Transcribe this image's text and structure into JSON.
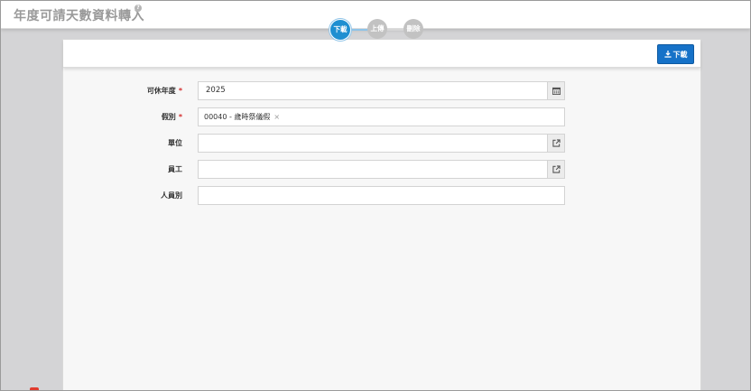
{
  "page": {
    "title": "年度可請天數資料轉入",
    "help_icon": "help-icon"
  },
  "stepper": {
    "steps": [
      {
        "label": "下載",
        "state": "active"
      },
      {
        "label": "上傳",
        "state": "inactive"
      },
      {
        "label": "刪除",
        "state": "inactive"
      }
    ]
  },
  "toolbar": {
    "download_label": "下載",
    "download_icon": "download-icon"
  },
  "form": {
    "year": {
      "label": "可休年度",
      "required": "*",
      "value": "2025",
      "button_icon": "calendar-icon"
    },
    "leave_type": {
      "label": "假別",
      "required": "*",
      "tag": "00040 - 歲時祭儀假",
      "remove": "×"
    },
    "unit": {
      "label": "單位",
      "value": "",
      "button_icon": "open-external-icon"
    },
    "employee": {
      "label": "員工",
      "value": "",
      "button_icon": "open-external-icon"
    },
    "staff_type": {
      "label": "人員別",
      "value": ""
    }
  },
  "colors": {
    "accent": "#1e8fd1",
    "button": "#1672c8",
    "required": "#d42b2b",
    "inactive_step": "#c2c2c2"
  }
}
